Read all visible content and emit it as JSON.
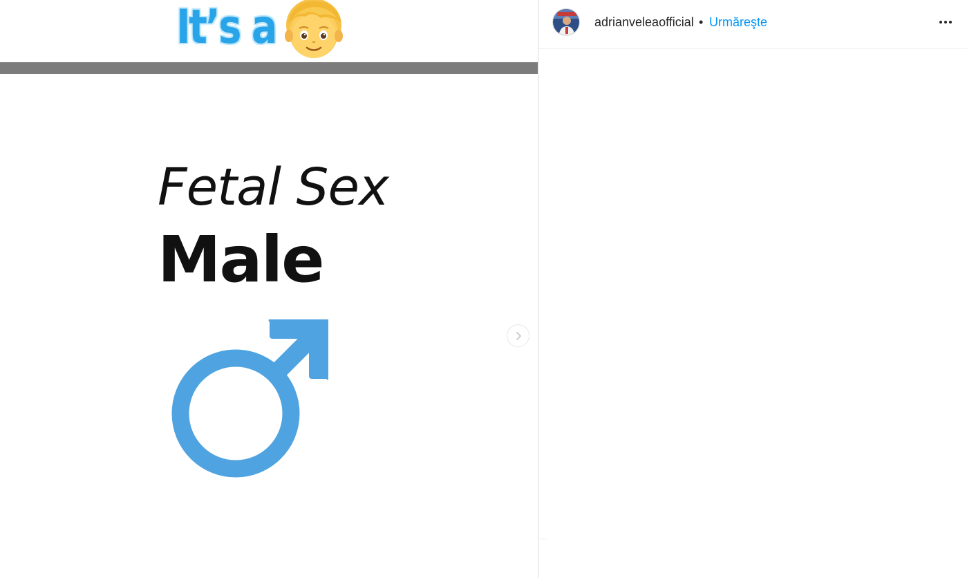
{
  "media": {
    "headline_text": "It’s a",
    "headline_emoji": "boy-face-emoji",
    "title_italic": "Fetal Sex",
    "title_bold": "Male",
    "symbol": "male-symbol-icon",
    "colors": {
      "headline": "#2aa4e8",
      "symbol": "#4fa3e0",
      "band": "#7c7c7c"
    },
    "next_icon": "chevron-right-icon"
  },
  "post_header": {
    "username": "adrianveleaofficial",
    "separator": "•",
    "follow_label": "Urmăreşte",
    "more_icon": "more-options-icon"
  }
}
